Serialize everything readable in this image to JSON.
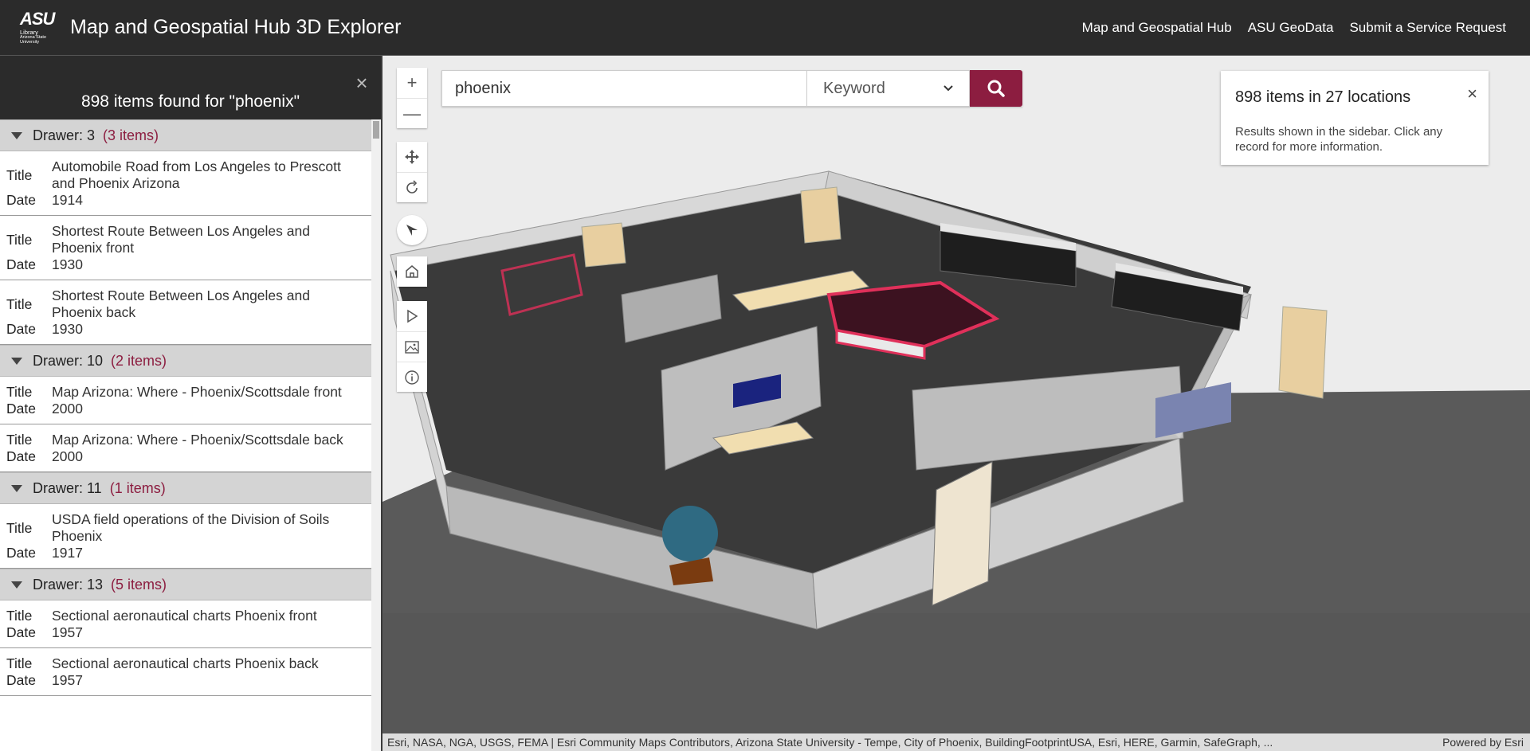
{
  "header": {
    "logo": {
      "line1": "ASU",
      "line2": "Library",
      "line3": "Arizona State University"
    },
    "title": "Map and Geospatial Hub 3D Explorer",
    "nav": [
      "Map and Geospatial Hub",
      "ASU GeoData",
      "Submit a Service Request"
    ]
  },
  "sidebar": {
    "summary": "898 items found for \"phoenix\"",
    "close_icon": "×",
    "title_key": "Title",
    "date_key": "Date",
    "drawers": [
      {
        "label": "Drawer: 3",
        "count": "(3 items)",
        "items": [
          {
            "title": "Automobile Road from Los Angeles to Prescott and Phoenix Arizona",
            "date": "1914"
          },
          {
            "title": "Shortest Route Between Los Angeles and Phoenix front",
            "date": "1930"
          },
          {
            "title": "Shortest Route Between Los Angeles and Phoenix back",
            "date": "1930"
          }
        ]
      },
      {
        "label": "Drawer: 10",
        "count": "(2 items)",
        "items": [
          {
            "title": "Map Arizona: Where - Phoenix/Scottsdale front",
            "date": "2000"
          },
          {
            "title": "Map Arizona: Where - Phoenix/Scottsdale back",
            "date": "2000"
          }
        ]
      },
      {
        "label": "Drawer: 11",
        "count": "(1 items)",
        "items": [
          {
            "title": "USDA field operations of the Division of Soils Phoenix",
            "date": "1917"
          }
        ]
      },
      {
        "label": "Drawer: 13",
        "count": "(5 items)",
        "items": [
          {
            "title": "Sectional aeronautical charts Phoenix front",
            "date": "1957"
          },
          {
            "title": "Sectional aeronautical charts Phoenix back",
            "date": "1957"
          }
        ]
      }
    ]
  },
  "search": {
    "value": "phoenix",
    "mode": "Keyword",
    "button_icon": "search-icon"
  },
  "popup": {
    "title": "898 items in 27 locations",
    "body": "Results shown in the sidebar. Click any record for more information.",
    "close_icon": "×"
  },
  "map_tools": {
    "zoom_in": "+",
    "zoom_out": "—"
  },
  "attribution": {
    "text": "Esri, NASA, NGA, USGS, FEMA | Esri Community Maps Contributors, Arizona State University - Tempe, City of Phoenix, BuildingFootprintUSA, Esri, HERE, Garmin, SafeGraph, ...",
    "powered": "Powered by Esri"
  },
  "colors": {
    "header_bg": "#2b2b2b",
    "accent": "#8c1d40",
    "drawer_bg": "#d4d4d4",
    "highlight": "#e0305a"
  }
}
